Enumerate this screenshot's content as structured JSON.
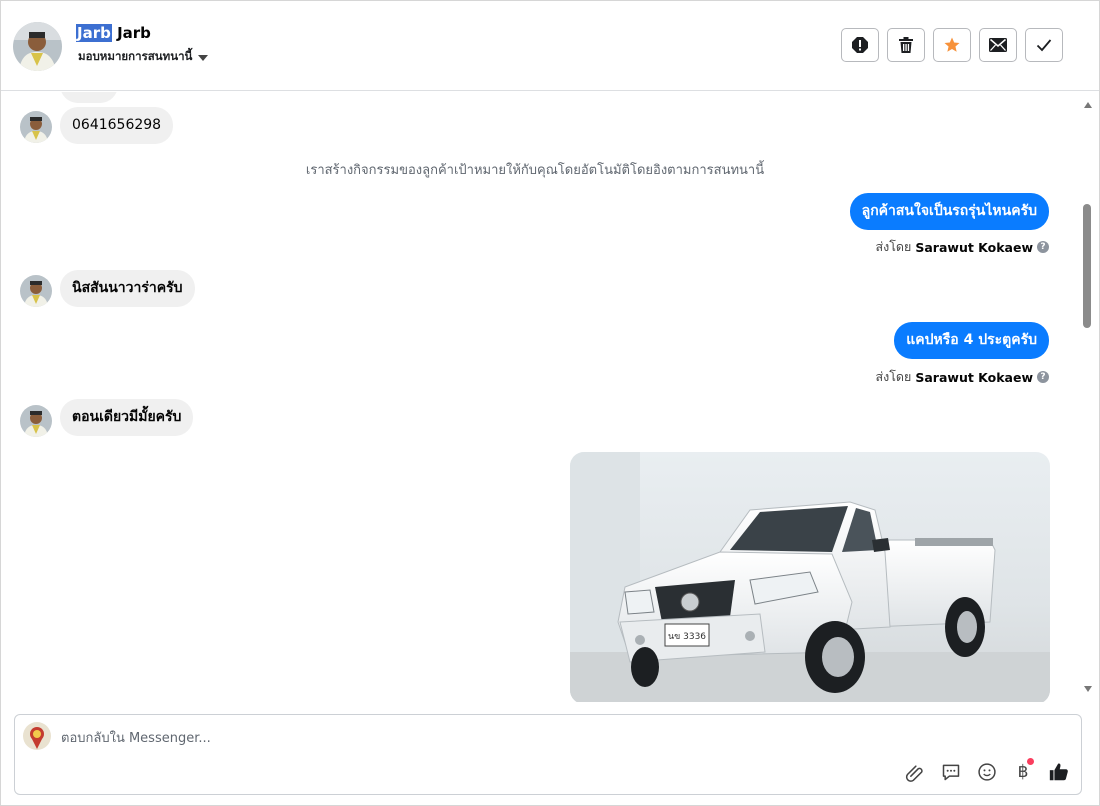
{
  "header": {
    "name_highlight": "Jarb",
    "name_rest": " Jarb",
    "assign_label": "มอบหมายการสนทนานี้",
    "actions": [
      "spam-icon",
      "trash-icon",
      "star-icon",
      "mail-icon",
      "check-icon"
    ],
    "star_color": "#f7923b"
  },
  "messages": {
    "phone": "0641656298",
    "system_note": "เราสร้างกิจกรรมของลูกค้าเป้าหมายให้กับคุณโดยอัตโนมัติโดยอิงตามการสนทนานี้",
    "out1": "ลูกค้าสนใจเป็นรถรุ่นไหนครับ",
    "sent_by_prefix": "ส่งโดย",
    "sender": "Sarawut Kokaew",
    "in2": "นิสสันนาวาร่าครับ",
    "out2": "แคปหรือ  4  ประตูครับ",
    "in3": "ตอนเดียวมีมั้ยครับ",
    "plate_text": "นข 3336"
  },
  "composer": {
    "placeholder": "ตอบกลับใน Messenger...",
    "tools": [
      "paperclip-icon",
      "speech-bubble-icon",
      "emoji-icon",
      "baht-icon",
      "like-icon"
    ],
    "baht_symbol": "฿"
  },
  "colors": {
    "outgoing_bubble": "#0a7cff",
    "incoming_bubble": "#f0f0f0",
    "highlight": "#3c6fd1"
  }
}
